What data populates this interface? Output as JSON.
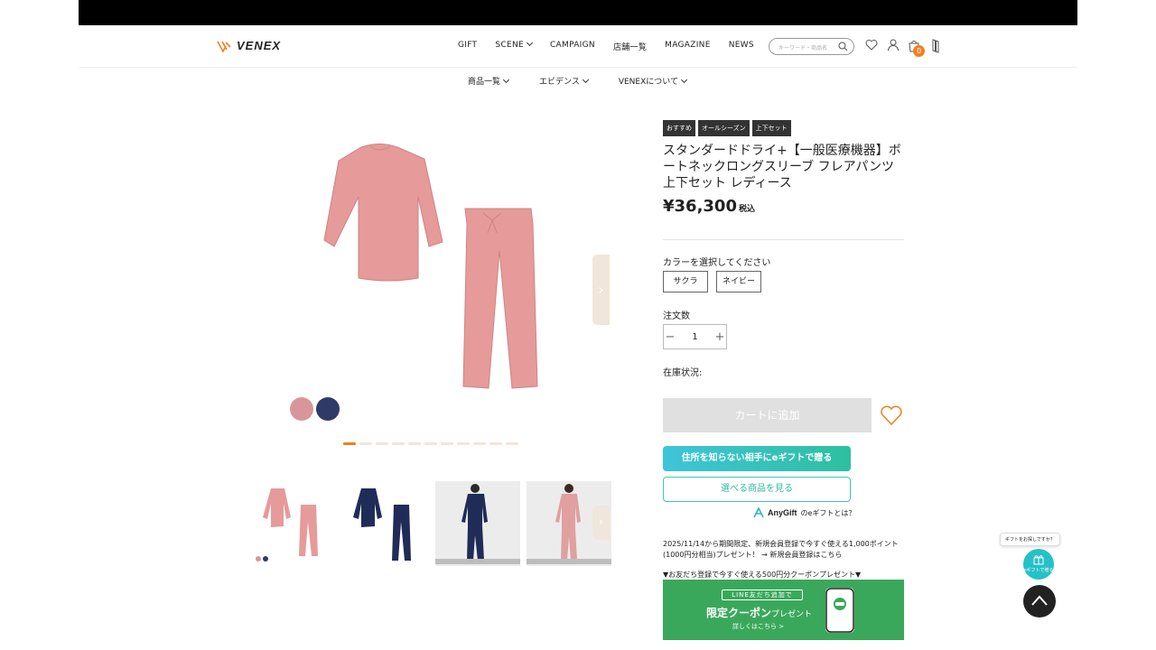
{
  "brand": {
    "name": "VENEX"
  },
  "nav": {
    "items": [
      "GIFT",
      "SCENE",
      "CAMPAIGN",
      "店舗一覧",
      "MAGAZINE",
      "NEWS"
    ],
    "search_placeholder": "キーワード・商品名",
    "cart_count": "0"
  },
  "subnav": {
    "items": [
      "商品一覧",
      "エビデンス",
      "VENEXについて"
    ]
  },
  "gallery": {
    "swatch_colors": [
      "#d9969a",
      "#2f3b66"
    ],
    "dot_count": 11,
    "active_dot": 0
  },
  "product": {
    "tags": [
      "おすすめ",
      "オールシーズン",
      "上下セット"
    ],
    "title": "スタンダードドライ+【一般医療機器】ボートネックロングスリーブ フレアパンツ 上下セット レディース",
    "price": "¥36,300",
    "tax_label": "税込",
    "color_label": "カラーを選択してください",
    "colors": [
      "サクラ",
      "ネイビー"
    ],
    "qty_label": "注文数",
    "qty_value": "1",
    "stock_label": "在庫状況:",
    "cart_button": "カートに追加",
    "egift_button": "住所を知らない相手にeギフトで贈る",
    "select_button": "選べる商品を見る",
    "anygift_brand": "AnyGift",
    "anygift_text": "のeギフトとは？",
    "notice": "2025/11/14から期間限定、新規会員登録で今すぐ使える1,000ポイント(1000円分相当)プレゼント！ → 新規会員登録はこちら",
    "line_heading": "▼お友だち登録で今すぐ使える500円分クーポンプレゼント▼",
    "line_pill": "LINE友だち追加で",
    "line_main": "限定クーポン",
    "line_main_suffix": "プレゼント",
    "line_sub": "詳しくはこちら >"
  },
  "floating": {
    "gift_tip": "ギフトをお探しですか？",
    "gift_label": "eギフトで贈る"
  },
  "colors": {
    "accent": "#f08020",
    "line_green": "#3aa85b",
    "egift_gradient": [
      "#3ec5d8",
      "#2ebfa0"
    ]
  }
}
